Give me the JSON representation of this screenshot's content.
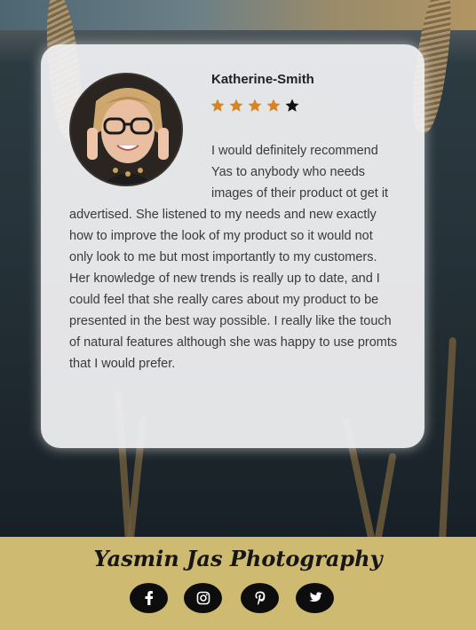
{
  "review_card": {
    "author": "Katherine-Smith",
    "rating": 4,
    "rating_max": 5,
    "text": "I would definitely recommend Yas to anybody who needs images of their product ot get it advertised. She listened to my needs and new exactly how to improve the look of my product so it would not only look to me but most importantly to my customers. Her knowledge of new trends is really up to date, and I could feel that she really cares about my product to be presented in the best way possible. I really like the touch of natural features although she was happy to use promts that I would prefer."
  },
  "footer": {
    "brand": "Yasmin Jas Photography",
    "social": [
      {
        "icon": "facebook-icon"
      },
      {
        "icon": "instagram-icon"
      },
      {
        "icon": "pinterest-icon"
      },
      {
        "icon": "twitter-icon"
      }
    ]
  },
  "colors": {
    "footer_bg": "#cfba72",
    "star_filled": "#d9851f",
    "star_empty": "#111111",
    "card_bg": "#f0f0f2"
  }
}
